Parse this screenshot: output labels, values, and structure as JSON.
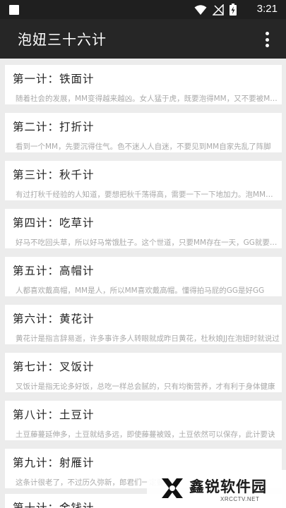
{
  "status_bar": {
    "time": "3:21",
    "icons": [
      "notification-square-icon",
      "wifi-icon",
      "no-signal-icon",
      "battery-charging-icon"
    ]
  },
  "app_bar": {
    "title": "泡妞三十六计",
    "menu_icon": "overflow-menu-icon"
  },
  "strategies": [
    {
      "title": "第一计：铁面计",
      "summary": "随着社会的发展，MM变得越来越凶。女人猛于虎，既要泡得MM，又不要被MM吃掉"
    },
    {
      "title": "第二计：打折计",
      "summary": "看到一个MM，先要沉得住气。色不迷人人自迷，不要见到MM自家先乱了阵脚"
    },
    {
      "title": "第三计：秋千计",
      "summary": "有过打秋千经验的人知道，要想把秋千荡得高，需要一下一下地加力。泡MM也是如此"
    },
    {
      "title": "第四计：吃草计",
      "summary": "好马不吃回头草，所以好马常饿肚子。这个世道，只要MM存在一天，GG就要吃草"
    },
    {
      "title": "第五计：高帽计",
      "summary": "人都喜欢戴高帽，MM是人，所以MM喜欢戴高帽。懂得拍马屁的GG是好GG"
    },
    {
      "title": "第六计：黄花计",
      "summary": "黄花计是指言辞易逝，许多事许多人转眼就成昨日黄花，杜秋娘JJ在泡妞时就说过"
    },
    {
      "title": "第七计：叉饭计",
      "summary": "叉饭计是指无论多好饭，总吃一样总会腻的，只有均衡营养，才有利于身体健康"
    },
    {
      "title": "第八计：土豆计",
      "summary": "土豆藤蔓延伸多，土豆就结多远，即使藤蔓被毁，土豆依然可以保存，此计要诀"
    },
    {
      "title": "第九计：射雁计",
      "summary": "这条计很老了，不过历久弥新，郎君们一定要学会"
    },
    {
      "title": "第十计：金钱计",
      "summary": ""
    }
  ],
  "watermark": {
    "name": "鑫锐软件园",
    "url": "XRCCTV.NET",
    "logo": "x-logo"
  },
  "colors": {
    "status_bar": "#1f1f1f",
    "app_bar": "#262626",
    "list_background": "#ececec",
    "card": "#ffffff",
    "title_text": "#222222",
    "summary_text": "#a9a9a9"
  }
}
